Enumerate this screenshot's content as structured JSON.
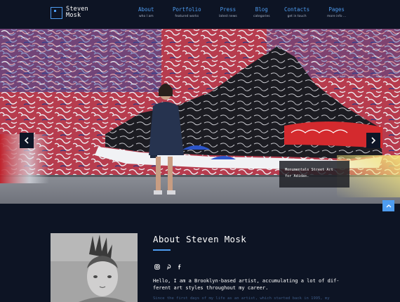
{
  "brand": {
    "line1": "Steven",
    "line2": "Mosk"
  },
  "nav": [
    {
      "title": "About",
      "subtitle": "who I am"
    },
    {
      "title": "Portfolio",
      "subtitle": "featured works"
    },
    {
      "title": "Press",
      "subtitle": "latest news"
    },
    {
      "title": "Blog",
      "subtitle": "categories"
    },
    {
      "title": "Contacts",
      "subtitle": "get in touch"
    },
    {
      "title": "Pages",
      "subtitle": "more info ..."
    }
  ],
  "hero": {
    "caption_line1": "Monumentals Street Art",
    "caption_line2": "for Adidas."
  },
  "about": {
    "title": "About Steven Mosk",
    "social_icons": [
      "instagram-icon",
      "pinterest-icon",
      "facebook-icon"
    ],
    "text_line1": "Hello, I am a Brooklyn-based artist, accumulating a lot of dif-",
    "text_line2": "ferent art styles throughout my career.",
    "text_faded": "Since the first days of my life as an artist, which started back in 1995, my"
  },
  "colors": {
    "background": "#0d1424",
    "accent": "#4e9cf0"
  }
}
